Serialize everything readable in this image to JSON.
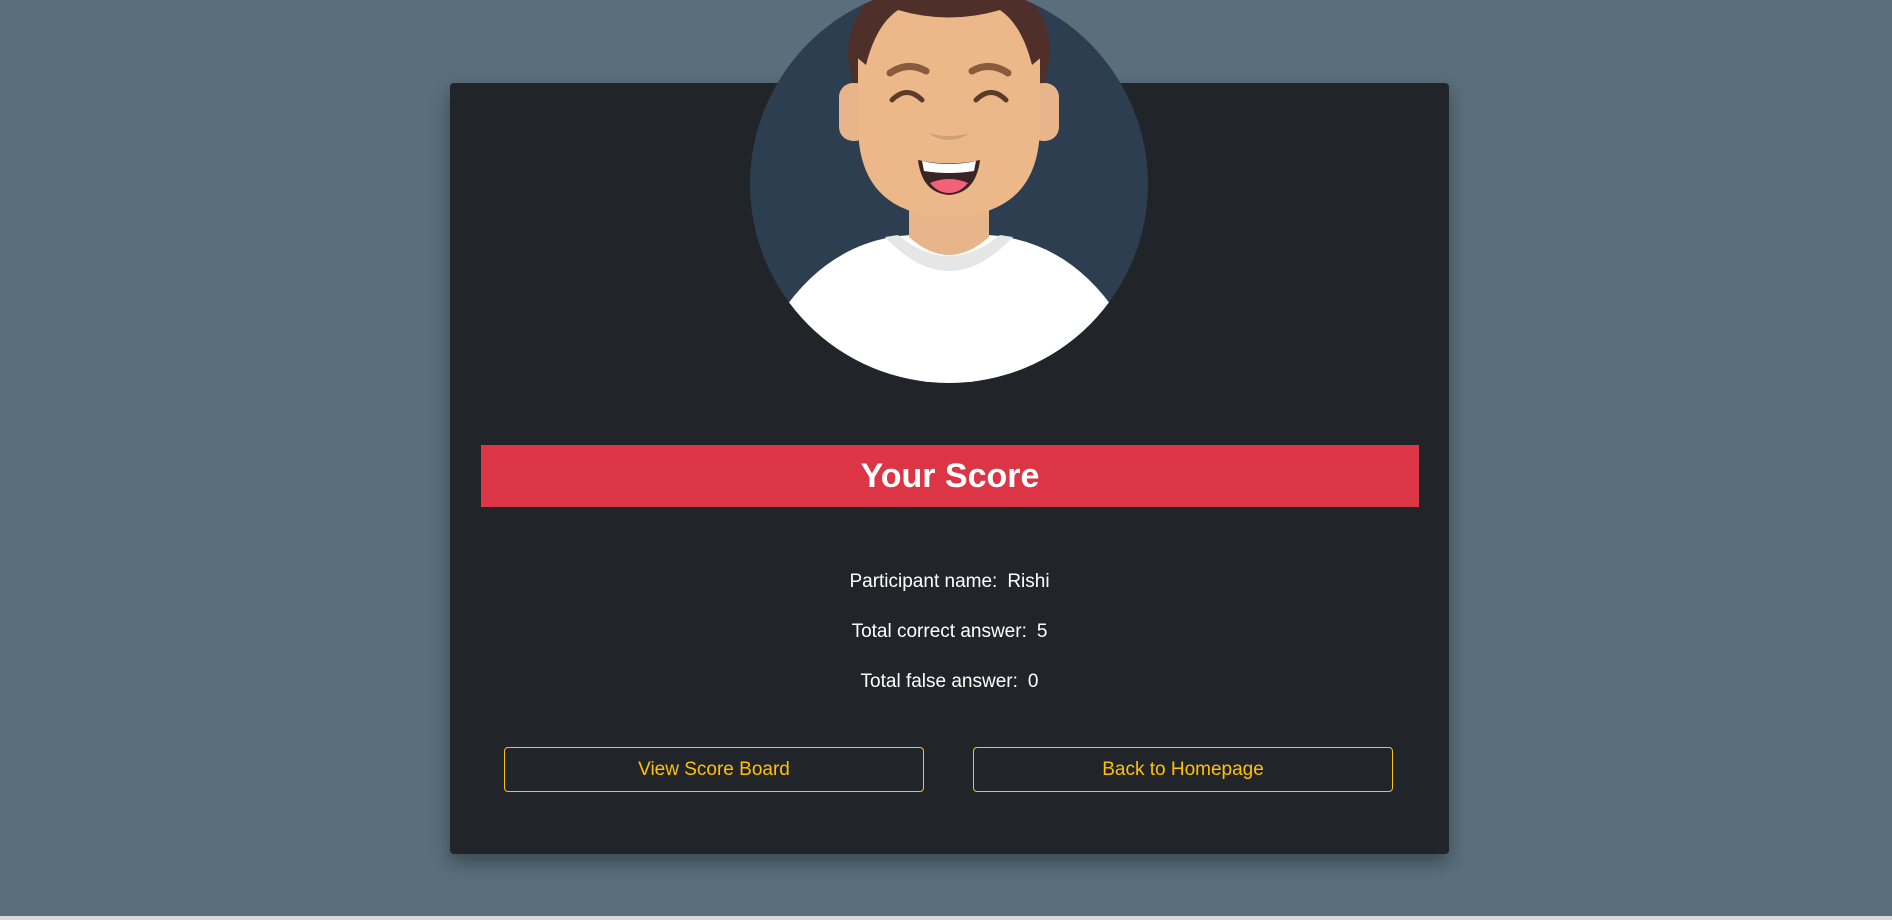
{
  "score": {
    "title": "Your Score",
    "participant_label": "Participant name:",
    "participant_value": "Rishi",
    "correct_label": "Total correct answer:",
    "correct_value": "5",
    "false_label": "Total false answer:",
    "false_value": "0"
  },
  "buttons": {
    "scoreboard_label": "View Score Board",
    "home_label": "Back to Homepage"
  },
  "colors": {
    "page_background": "#5a6e7b",
    "card_background": "#212429",
    "banner": "#dc3545",
    "button_outline": "#ffc107"
  },
  "avatar": {
    "icon": "smiling-man-avatar-icon"
  }
}
